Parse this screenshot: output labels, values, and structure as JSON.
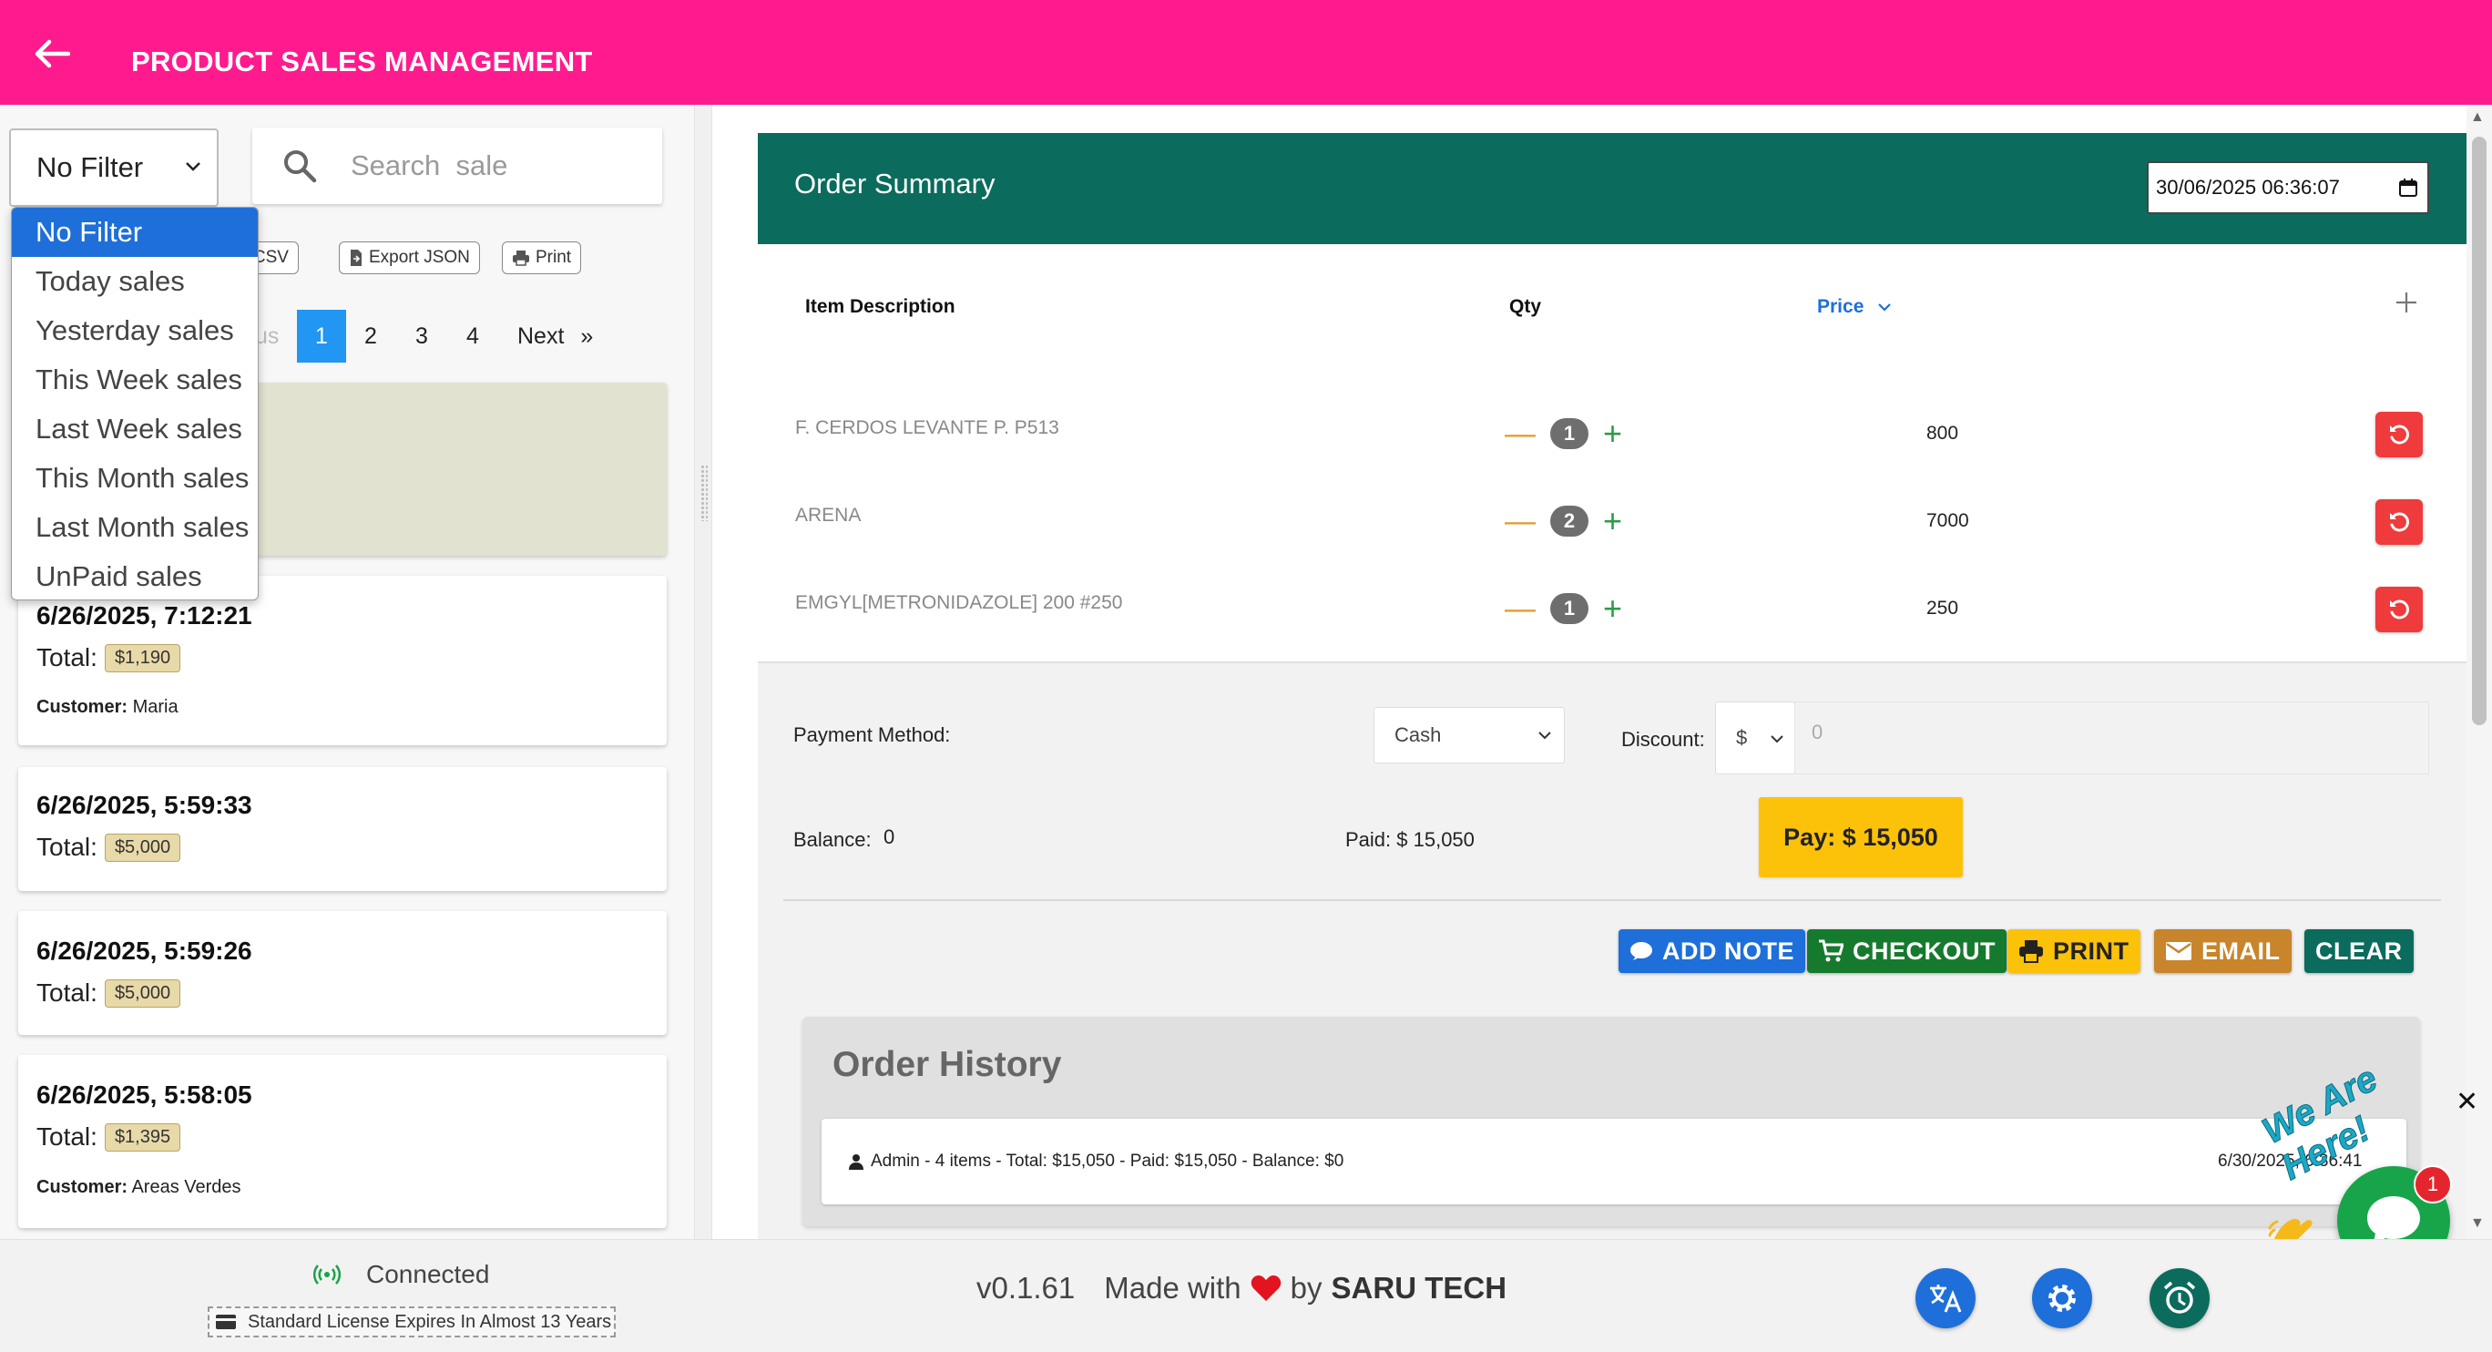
{
  "header": {
    "title": "PRODUCT SALES MANAGEMENT"
  },
  "filter": {
    "selected": "No Filter",
    "options": [
      "No Filter",
      "Today sales",
      "Yesterday sales",
      "This Week sales",
      "Last Week sales",
      "This Month sales",
      "Last Month sales",
      "UnPaid sales"
    ]
  },
  "search": {
    "placeholder": "Search  sale"
  },
  "toolbar": {
    "export_csv": "rt CSV",
    "export_json": "Export JSON",
    "print": "Print"
  },
  "pagination": {
    "prev_partial": "us",
    "pages": [
      "1",
      "2",
      "3",
      "4"
    ],
    "next": "Next",
    "next_arrow": "»"
  },
  "sales": [
    {
      "date": "6/26/2025, 7:12:21",
      "total_label": "Total:",
      "total": "$1,190",
      "customer_label": "Customer:",
      "customer": "Maria"
    },
    {
      "date": "6/26/2025, 5:59:33",
      "total_label": "Total:",
      "total": "$5,000"
    },
    {
      "date": "6/26/2025, 5:59:26",
      "total_label": "Total:",
      "total": "$5,000"
    },
    {
      "date": "6/26/2025, 5:58:05",
      "total_label": "Total:",
      "total": "$1,395",
      "customer_label": "Customer:",
      "customer": "Areas Verdes"
    }
  ],
  "footer": {
    "status": "Connected",
    "license": "Standard License Expires In Almost 13 Years",
    "version": "v0.1.61",
    "made_with": "Made with",
    "by": "by",
    "company": "SARU TECH"
  },
  "order": {
    "title": "Order Summary",
    "datetime": "30/06/2025 06:36:07",
    "columns": {
      "description": "Item Description",
      "qty": "Qty",
      "price": "Price"
    },
    "items": [
      {
        "description": "F. CERDOS LEVANTE P. P513",
        "qty": "1",
        "price": "800"
      },
      {
        "description": "ARENA",
        "qty": "2",
        "price": "7000"
      },
      {
        "description": "EMGYL[METRONIDAZOLE] 200 #250",
        "qty": "1",
        "price": "250"
      }
    ],
    "payment_method_label": "Payment Method:",
    "payment_method": "Cash",
    "discount_label": "Discount:",
    "discount_type": "$",
    "discount_value": "0",
    "balance_label": "Balance:",
    "balance": "0",
    "paid": "Paid: $ 15,050",
    "pay_button": "Pay: $ 15,050"
  },
  "actions": {
    "add_note": "ADD NOTE",
    "checkout": "CHECKOUT",
    "print": "PRINT",
    "email": "EMAIL",
    "clear": "CLEAR"
  },
  "history": {
    "title": "Order History",
    "entries": [
      {
        "summary": "Admin -   4 items - Total: $15,050 - Paid: $15,050 - Balance: $0",
        "date": "6/30/2025, 6:36:41"
      }
    ]
  },
  "chat": {
    "tagline": "We Are Here!",
    "notifications": "1"
  },
  "colors": {
    "header": "#ff1b8d",
    "order_header": "#0b6b5d",
    "pay_button": "#fcc20a",
    "accent_blue": "#1e6fd9"
  }
}
